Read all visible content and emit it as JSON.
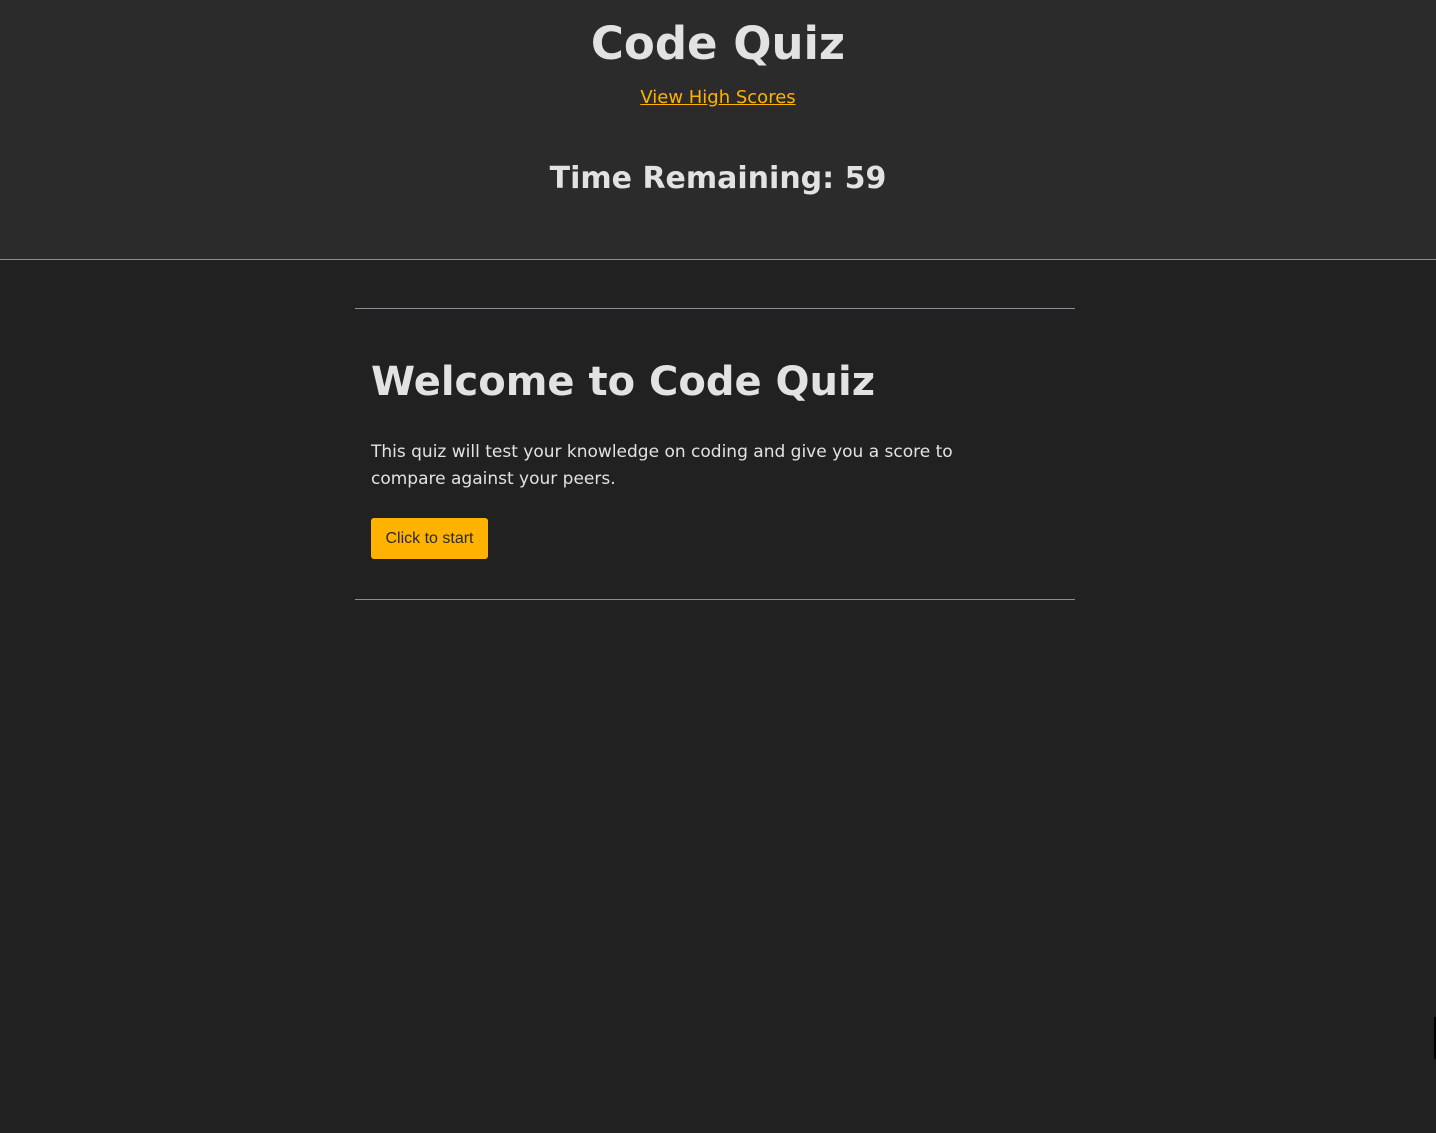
{
  "header": {
    "title": "Code Quiz",
    "high_scores_link": "View High Scores",
    "timer_text": "Time Remaining: 59"
  },
  "main": {
    "heading": "Welcome to Code Quiz",
    "description": "This quiz will test your knowledge on coding and give you a score to compare against your peers.",
    "start_button": "Click to start"
  },
  "colors": {
    "accent": "#ffb300",
    "header_background": "#2b2b2b",
    "page_background": "#212121",
    "divider": "#8a8a98",
    "text": "#e2e2e2"
  }
}
